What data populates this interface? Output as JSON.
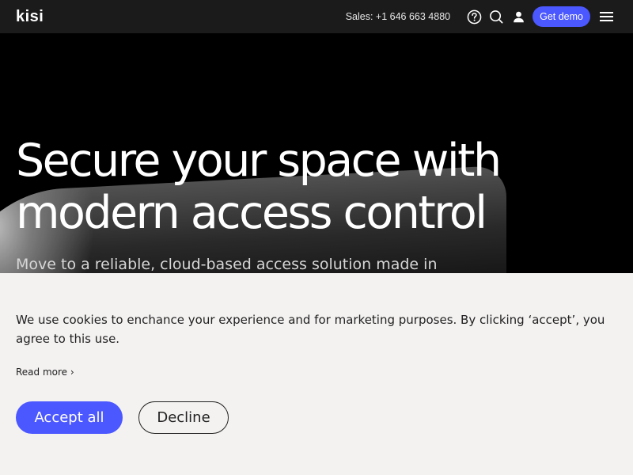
{
  "header": {
    "logo": "kisi",
    "sales": "Sales: +1 646 663 4880",
    "icons": [
      "help-icon",
      "search-icon",
      "user-icon",
      "menu-icon"
    ],
    "demo_label": "Get demo",
    "demo_color": "#4b57ff"
  },
  "hero": {
    "headline_line1": "Secure your space with",
    "headline_line2": "modern access control",
    "subline": "Move to a reliable, cloud-based access solution made in"
  },
  "cookie": {
    "text": "We use cookies to enchance your experience and for marketing purposes. By clicking ‘accept’, you agree to this use.",
    "read_more": "Read more ›",
    "accept_label": "Accept all",
    "decline_label": "Decline",
    "accent_color": "#4b57ff",
    "background": "#f3f2f1"
  }
}
